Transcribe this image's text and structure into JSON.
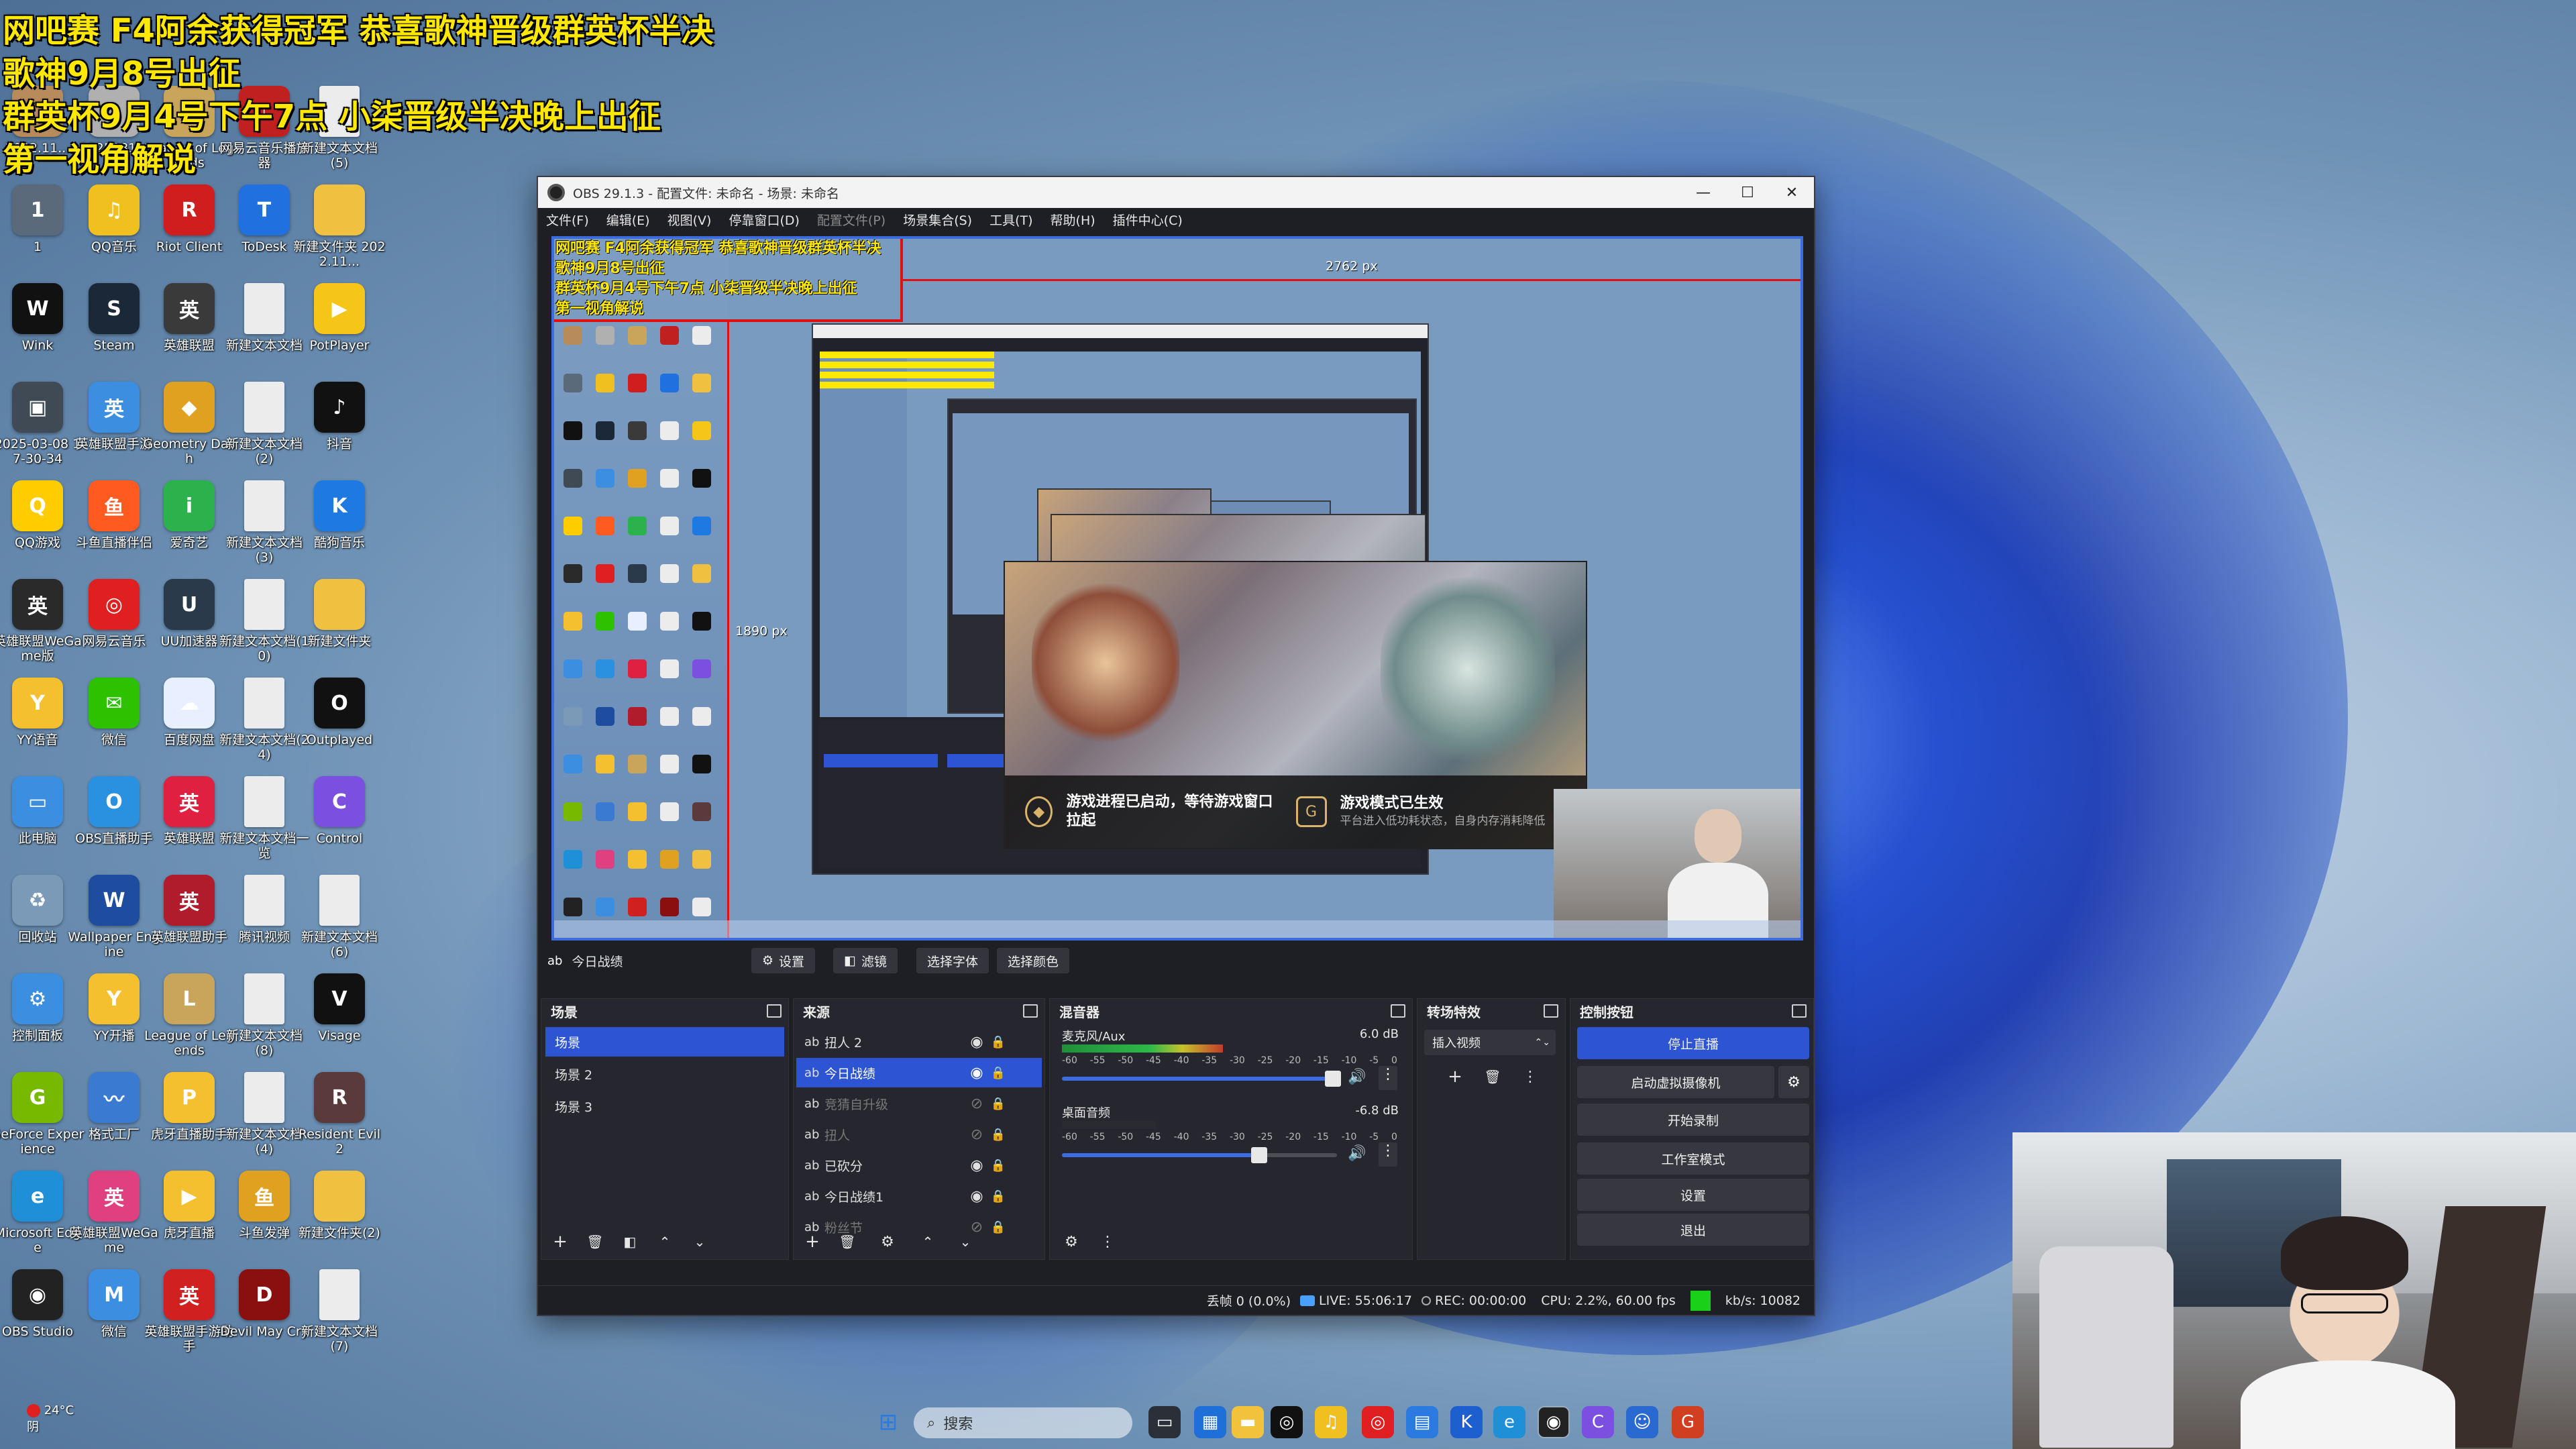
{
  "overlay": {
    "line1": "网吧赛 F4阿余获得冠军 恭喜歌神晋级群英杯半决",
    "line2": "歌神9月8号出征",
    "line3": "群英杯9月4号下午7点 小柒晋级半决晚上出征",
    "line4": "第一视角解说"
  },
  "desktop_icons": [
    {
      "label": "2022.11...",
      "color": "#b88b5a",
      "glyph": ""
    },
    {
      "label": "2025081...",
      "color": "#b0b0b0",
      "glyph": ""
    },
    {
      "label": "League of Legends",
      "color": "#c8a55a",
      "glyph": "L"
    },
    {
      "label": "网易云音乐播放器",
      "color": "#c02020",
      "glyph": "♪"
    },
    {
      "label": "新建文本文档(5)",
      "color": "#ececec",
      "glyph": ""
    },
    {
      "label": "1",
      "color": "#5a6a7a",
      "glyph": "1"
    },
    {
      "label": "QQ音乐",
      "color": "#f0c020",
      "glyph": "♫"
    },
    {
      "label": "Riot Client",
      "color": "#d01e1e",
      "glyph": "R"
    },
    {
      "label": "ToDesk",
      "color": "#2070e0",
      "glyph": "T"
    },
    {
      "label": "新建文件夹 2022.11...",
      "color": "#f0c040",
      "glyph": ""
    },
    {
      "label": "Wink",
      "color": "#111111",
      "glyph": "W"
    },
    {
      "label": "Steam",
      "color": "#1b2838",
      "glyph": "S"
    },
    {
      "label": "英雄联盟",
      "color": "#3a3a3a",
      "glyph": "英"
    },
    {
      "label": "新建文本文档",
      "color": "#ececec",
      "glyph": ""
    },
    {
      "label": "PotPlayer",
      "color": "#f5c518",
      "glyph": "▶"
    },
    {
      "label": "2025-03-08 17-30-34",
      "color": "#404a55",
      "glyph": "▣"
    },
    {
      "label": "英雄联盟手游",
      "color": "#3b8ee0",
      "glyph": "英"
    },
    {
      "label": "Geometry Dash",
      "color": "#e0a020",
      "glyph": "◆"
    },
    {
      "label": "新建文本文档(2)",
      "color": "#ececec",
      "glyph": ""
    },
    {
      "label": "抖音",
      "color": "#111111",
      "glyph": "♪"
    },
    {
      "label": "QQ游戏",
      "color": "#ffcc00",
      "glyph": "Q"
    },
    {
      "label": "斗鱼直播伴侣",
      "color": "#ff5a20",
      "glyph": "鱼"
    },
    {
      "label": "爱奇艺",
      "color": "#2bb24c",
      "glyph": "i"
    },
    {
      "label": "新建文本文档(3)",
      "color": "#ececec",
      "glyph": ""
    },
    {
      "label": "酷狗音乐",
      "color": "#1e7ae0",
      "glyph": "K"
    },
    {
      "label": "英雄联盟WeGame版",
      "color": "#2a2a2a",
      "glyph": "英"
    },
    {
      "label": "网易云音乐",
      "color": "#e02020",
      "glyph": "◎"
    },
    {
      "label": "UU加速器",
      "color": "#2a3a4a",
      "glyph": "U"
    },
    {
      "label": "新建文本文档(10)",
      "color": "#ececec",
      "glyph": ""
    },
    {
      "label": "新建文件夹",
      "color": "#f0c040",
      "glyph": ""
    },
    {
      "label": "YY语音",
      "color": "#f5c030",
      "glyph": "Y"
    },
    {
      "label": "微信",
      "color": "#2dc100",
      "glyph": "✉"
    },
    {
      "label": "百度网盘",
      "color": "#e8f0ff",
      "glyph": "☁"
    },
    {
      "label": "新建文本文档(24)",
      "color": "#ececec",
      "glyph": ""
    },
    {
      "label": "Outplayed",
      "color": "#111111",
      "glyph": "O"
    },
    {
      "label": "此电脑",
      "color": "#3b8ee0",
      "glyph": "▭"
    },
    {
      "label": "OBS直播助手",
      "color": "#2a90e0",
      "glyph": "O"
    },
    {
      "label": "英雄联盟",
      "color": "#e02040",
      "glyph": "英"
    },
    {
      "label": "新建文本文档一览",
      "color": "#ececec",
      "glyph": ""
    },
    {
      "label": "Control",
      "color": "#7b4fe0",
      "glyph": "C"
    },
    {
      "label": "回收站",
      "color": "#7a9ab8",
      "glyph": "♻"
    },
    {
      "label": "Wallpaper Engine",
      "color": "#1e4da0",
      "glyph": "W"
    },
    {
      "label": "英雄联盟助手",
      "color": "#b01c2c",
      "glyph": "英"
    },
    {
      "label": "腾讯视频",
      "color": "#ececec",
      "glyph": ""
    },
    {
      "label": "新建文本文档(6)",
      "color": "#ececec",
      "glyph": ""
    },
    {
      "label": "控制面板",
      "color": "#3b8ee0",
      "glyph": "⚙"
    },
    {
      "label": "YY开播",
      "color": "#f5c030",
      "glyph": "Y"
    },
    {
      "label": "League of Legends",
      "color": "#c8a55a",
      "glyph": "L"
    },
    {
      "label": "新建文本文档(8)",
      "color": "#ececec",
      "glyph": ""
    },
    {
      "label": "Visage",
      "color": "#111111",
      "glyph": "V"
    },
    {
      "label": "GeForce Experience",
      "color": "#76b900",
      "glyph": "G"
    },
    {
      "label": "格式工厂",
      "color": "#3a7ad0",
      "glyph": "〰"
    },
    {
      "label": "虎牙直播助手",
      "color": "#f5c030",
      "glyph": "P"
    },
    {
      "label": "新建文本文档(4)",
      "color": "#ececec",
      "glyph": ""
    },
    {
      "label": "Resident Evil 2",
      "color": "#5a3a3a",
      "glyph": "R"
    },
    {
      "label": "Microsoft Edge",
      "color": "#1f90d8",
      "glyph": "e"
    },
    {
      "label": "英雄联盟WeGame",
      "color": "#e04080",
      "glyph": "英"
    },
    {
      "label": "虎牙直播",
      "color": "#f5c030",
      "glyph": "▶"
    },
    {
      "label": "斗鱼发弹",
      "color": "#e0a020",
      "glyph": "鱼"
    },
    {
      "label": "新建文件夹(2)",
      "color": "#f0c040",
      "glyph": ""
    },
    {
      "label": "OBS Studio",
      "color": "#222222",
      "glyph": "◉"
    },
    {
      "label": "微信",
      "color": "#3b8ee0",
      "glyph": "M"
    },
    {
      "label": "英雄联盟手游助手",
      "color": "#d02020",
      "glyph": "英"
    },
    {
      "label": "Devil May Cry",
      "color": "#8a1010",
      "glyph": "D"
    },
    {
      "label": "新建文本文档(7)",
      "color": "#ececec",
      "glyph": ""
    }
  ],
  "weather": {
    "temp": "24°C",
    "cond": "阴"
  },
  "obs": {
    "title": "OBS 29.1.3 - 配置文件: 未命名 - 场景: 未命名",
    "menu": [
      "文件(F)",
      "编辑(E)",
      "视图(V)",
      "停靠窗口(D)",
      "配置文件(P)",
      "场景集合(S)",
      "工具(T)",
      "帮助(H)",
      "插件中心(C)"
    ],
    "preview": {
      "width_label": "2762 px",
      "height_label": "1890 px",
      "splash_msg1": "游戏进程已启动，等待游戏窗口拉起",
      "splash_msg2_title": "游戏模式已生效",
      "splash_msg2_sub": "平台进入低功耗状态，自身内存消耗降低"
    },
    "source_toolbar": {
      "current": "今日战绩",
      "settings": "设置",
      "filters": "滤镜",
      "font": "选择字体",
      "color": "选择颜色"
    },
    "scenes": {
      "title": "场景",
      "items": [
        "场景",
        "场景 2",
        "场景 3"
      ]
    },
    "sources": {
      "title": "来源",
      "items": [
        "扭人 2",
        "今日战绩",
        "竞猜自升级",
        "扭人",
        "已砍分",
        "今日战绩1",
        "粉丝节"
      ]
    },
    "mixer": {
      "title": "混音器",
      "ch1_name": "麦克风/Aux",
      "ch1_db": "6.0 dB",
      "ch2_name": "桌面音频",
      "ch2_db": "-6.8 dB",
      "ticks": [
        "-60",
        "-55",
        "-50",
        "-45",
        "-40",
        "-35",
        "-30",
        "-25",
        "-20",
        "-15",
        "-10",
        "-5",
        "0"
      ]
    },
    "transitions": {
      "title": "转场特效",
      "select": "插入视频"
    },
    "controls": {
      "title": "控制按钮",
      "stop_stream": "停止直播",
      "virtual_cam": "启动虚拟摄像机",
      "start_rec": "开始录制",
      "studio_mode": "工作室模式",
      "settings": "设置",
      "exit": "退出"
    },
    "status": {
      "dropped": "丢帧 0 (0.0%)",
      "live": "LIVE: 55:06:17",
      "rec": "REC: 00:00:00",
      "cpu": "CPU: 2.2%, 60.00 fps",
      "kbps": "kb/s: 10082"
    }
  },
  "taskbar": {
    "search_placeholder": "搜索"
  },
  "colors": {
    "overlay_text": "#ffe800",
    "accent": "#2d55d3",
    "live_green": "#19d119"
  }
}
